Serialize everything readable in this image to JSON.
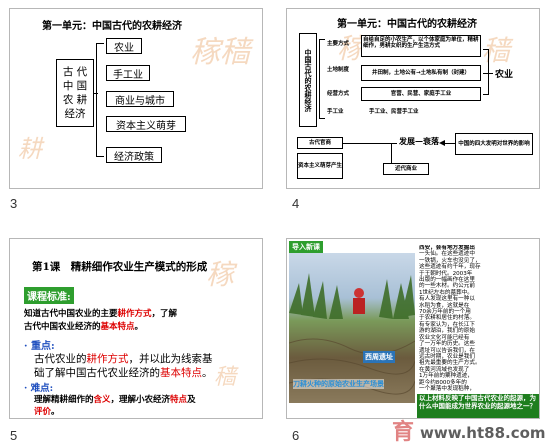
{
  "slide_numbers": [
    "3",
    "4",
    "5",
    "6"
  ],
  "slide3": {
    "title": "第一单元：中国古代的农耕经济",
    "left_lines": [
      "古 代",
      "中 国",
      "农 耕",
      "经济"
    ],
    "items": [
      "农业",
      "手工业",
      "商业与城市",
      "资本主义萌芽",
      "经济政策"
    ]
  },
  "slide4": {
    "title": "第一单元：中国古代的农耕经济",
    "left_vertical": "中国古代的农耕经济",
    "labels": [
      "主要方式",
      "土地制度",
      "经营方式",
      "手工业"
    ],
    "rows": [
      "自给自足的小农生产，以个体家庭为单位，精耕细作，男耕女织的生产生活方式",
      "井田制，土地公有→土地私有制（封建）",
      "官营、民营、家庭手工业",
      "手工业、民营手工业"
    ],
    "side_label": "农业",
    "bottom_left": "古代官商",
    "bottom_mid": "发展—衰落",
    "bottom_left2": "资本主义萌芽产生",
    "bottom_mid2": "近代商业",
    "bottom_right": "中国的四大发明对世界的影响"
  },
  "slide5": {
    "title": "第1课　精耕细作农业生产模式的形成",
    "label_standard": "课程标准:",
    "standard_line1_a": "知道古代中国农业的主要",
    "standard_line1_b": "耕作方式",
    "standard_line1_c": "，了解",
    "standard_line2_a": "古代中国农业经济的",
    "standard_line2_b": "基本特点",
    "standard_line2_c": "。",
    "key_label": "重点:",
    "key_line1_a": "古代农业的",
    "key_line1_b": "耕作方式",
    "key_line1_c": "，并以此为线索基",
    "key_line2_a": "础了解中国古代农业经济的",
    "key_line2_b": "基本特点",
    "key_line2_c": "。",
    "diff_label": "难点:",
    "diff_line1_a": "理解精耕细作的",
    "diff_line1_b": "含义",
    "diff_line1_c": "，理解小农经济",
    "diff_line1_d": "特点",
    "diff_line1_e": "及",
    "diff_line2": "评价",
    "diff_line2_b": "。"
  },
  "slide6": {
    "tag": "导入新课",
    "photo_caption": "西周遗址",
    "bottom_caption": "刀耕火种的原始农业生产场景",
    "right_text_lines": [
      "西安，会有地方发掘出",
      "一头仙。在这些遗迹中",
      "一铁锅，火车也没见了，",
      "这些遗迹有约千年，现存",
      "于王朝时代。2003年",
      "出版的一幅画作在这里",
      "的一些木材。约公元前",
      "1世纪左右的墓葬中。",
      "有人发现这里有一种以",
      "水稻为食，这就是在",
      "70余万年前的一个用",
      "于农耕和居住的村落。",
      "有专家认为，在长江下",
      "游的湖泊，我们的原始",
      "农业文化可能已经有",
      "了一万年的历史。这些",
      "遗址可以告诉我们，在",
      "远古时期，农业是我们",
      "祖先最重要的生产方式。",
      "在黄河流域也发现了",
      "1万年前的粟种遗迹，",
      "距今约8000多年的",
      "一个聚落中发现稻种，",
      "粮食和工具已经出现。"
    ],
    "bottom_box": "以上材料反映了中国古代农业的起源，为什么中国能成为世界农业的起源地之一？"
  },
  "watermark": {
    "left": "育",
    "right": "www.ht88.com"
  },
  "colors": {
    "red": "#dd0000",
    "blue": "#1f4fbf",
    "green": "#2e9e2e",
    "photo_green": "#4d7a3a"
  }
}
